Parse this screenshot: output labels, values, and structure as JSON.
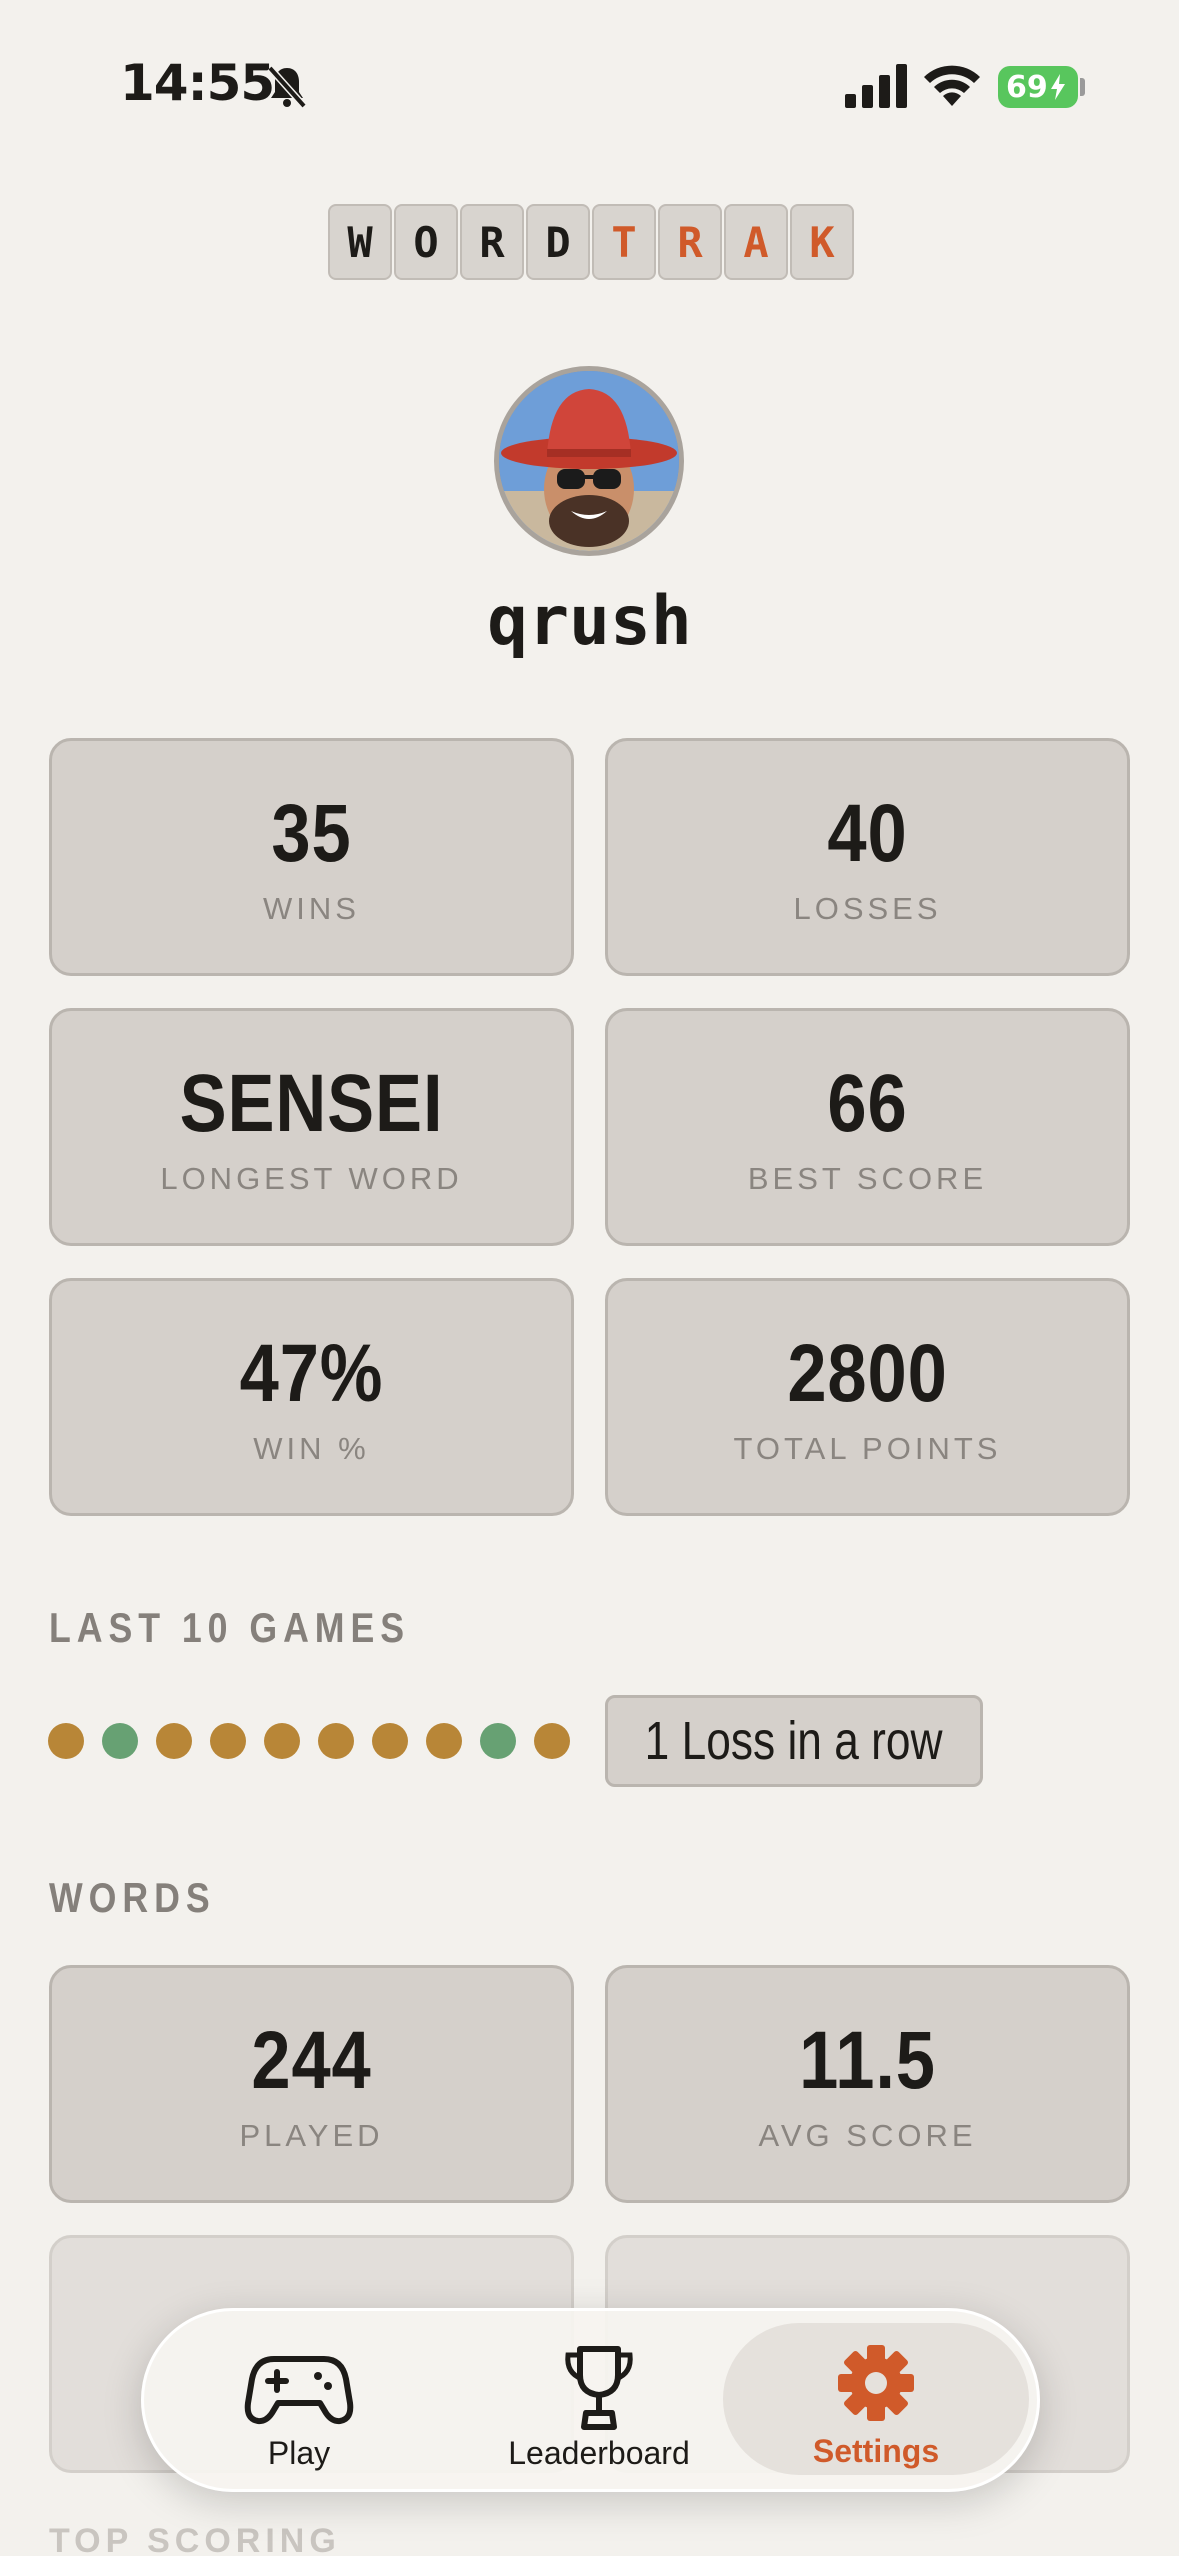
{
  "status_bar": {
    "time": "14:55",
    "battery": "69"
  },
  "logo": {
    "letters": [
      "W",
      "O",
      "R",
      "D",
      "T",
      "R",
      "A",
      "K"
    ]
  },
  "profile": {
    "username": "qrush"
  },
  "stats": {
    "wins": {
      "value": "35",
      "label": "WINS"
    },
    "losses": {
      "value": "40",
      "label": "LOSSES"
    },
    "longest_word": {
      "value": "SENSEI",
      "label": "LONGEST WORD"
    },
    "best_score": {
      "value": "66",
      "label": "BEST SCORE"
    },
    "win_pct": {
      "value": "47%",
      "label": "WIN %"
    },
    "total_points": {
      "value": "2800",
      "label": "TOTAL POINTS"
    }
  },
  "last_games": {
    "title": "LAST 10 GAMES",
    "results": [
      "loss",
      "win",
      "loss",
      "loss",
      "loss",
      "loss",
      "loss",
      "loss",
      "win",
      "loss"
    ],
    "streak": "1 Loss in a row"
  },
  "words": {
    "title": "WORDS",
    "played": {
      "value": "244",
      "label": "PLAYED"
    },
    "avg_score": {
      "value": "11.5",
      "label": "AVG SCORE"
    }
  },
  "bottom_section": {
    "title": "TOP SCORING"
  },
  "tabs": {
    "play": "Play",
    "leaderboard": "Leaderboard",
    "settings": "Settings"
  },
  "colors": {
    "accent": "#d05a2a",
    "win_dot": "#67a173",
    "loss_dot": "#b88637",
    "card_bg": "#d5d0cb",
    "page_bg": "#f3f1ed"
  }
}
